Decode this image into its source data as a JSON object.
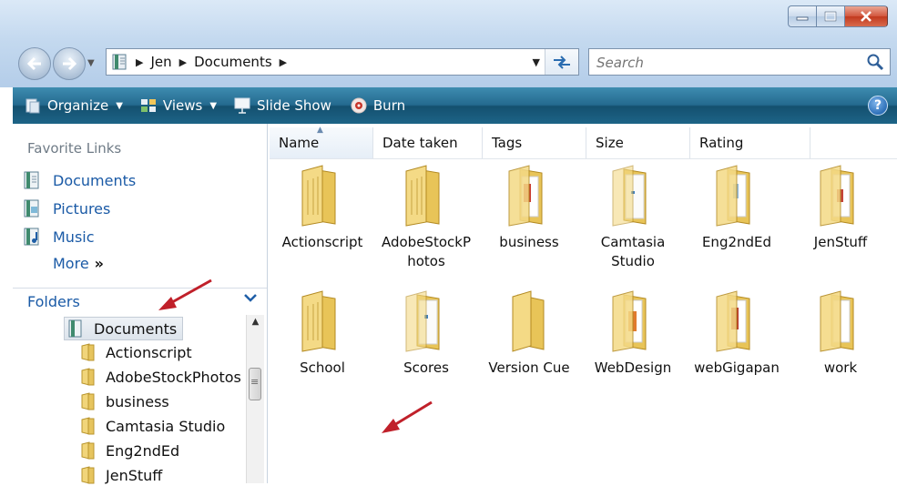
{
  "window": {
    "controls": [
      {
        "name": "minimize-button",
        "glyph": "▁"
      },
      {
        "name": "maximize-button",
        "glyph": "▢"
      },
      {
        "name": "close-button",
        "glyph": "✕"
      }
    ]
  },
  "address": {
    "breadcrumbs": [
      "Jen",
      "Documents"
    ],
    "search_placeholder": "Search"
  },
  "toolbar": {
    "items": [
      {
        "label": "Organize",
        "has_menu": true,
        "icon": "organize-icon"
      },
      {
        "label": "Views",
        "has_menu": true,
        "icon": "views-icon"
      },
      {
        "label": "Slide Show",
        "has_menu": false,
        "icon": "slideshow-icon"
      },
      {
        "label": "Burn",
        "has_menu": false,
        "icon": "burn-icon"
      }
    ],
    "help_glyph": "?"
  },
  "nav": {
    "favorites_heading": "Favorite Links",
    "favorites": [
      {
        "label": "Documents",
        "icon": "documents-icon"
      },
      {
        "label": "Pictures",
        "icon": "pictures-icon"
      },
      {
        "label": "Music",
        "icon": "music-icon"
      }
    ],
    "more_label": "More",
    "more_glyph": "»",
    "folders_label": "Folders",
    "tree": [
      {
        "label": "Documents",
        "selected": true,
        "root": true
      },
      {
        "label": "Actionscript"
      },
      {
        "label": "AdobeStockPhotos"
      },
      {
        "label": "business"
      },
      {
        "label": "Camtasia Studio"
      },
      {
        "label": "Eng2ndEd"
      },
      {
        "label": "JenStuff"
      }
    ]
  },
  "columns": [
    "Name",
    "Date taken",
    "Tags",
    "Size",
    "Rating"
  ],
  "files": [
    {
      "label": "Actionscript",
      "variant": "plain"
    },
    {
      "label": "AdobeStockP hotos",
      "variant": "plain"
    },
    {
      "label": "business",
      "variant": "red"
    },
    {
      "label": "Camtasia Studio",
      "variant": "paper"
    },
    {
      "label": "Eng2ndEd",
      "variant": "blue"
    },
    {
      "label": "JenStuff",
      "variant": "red"
    },
    {
      "label": "School",
      "variant": "plain"
    },
    {
      "label": "Scores",
      "variant": "paper"
    },
    {
      "label": "Version Cue",
      "variant": "empty"
    },
    {
      "label": "WebDesign",
      "variant": "orange"
    },
    {
      "label": "webGigapan",
      "variant": "red"
    },
    {
      "label": "work",
      "variant": "plain"
    }
  ],
  "colors": {
    "command_bar": "#246a8f",
    "link_blue": "#1a5aa6",
    "annotation_arrow": "#c0202a",
    "folder_yellow": "#f1d57a"
  }
}
